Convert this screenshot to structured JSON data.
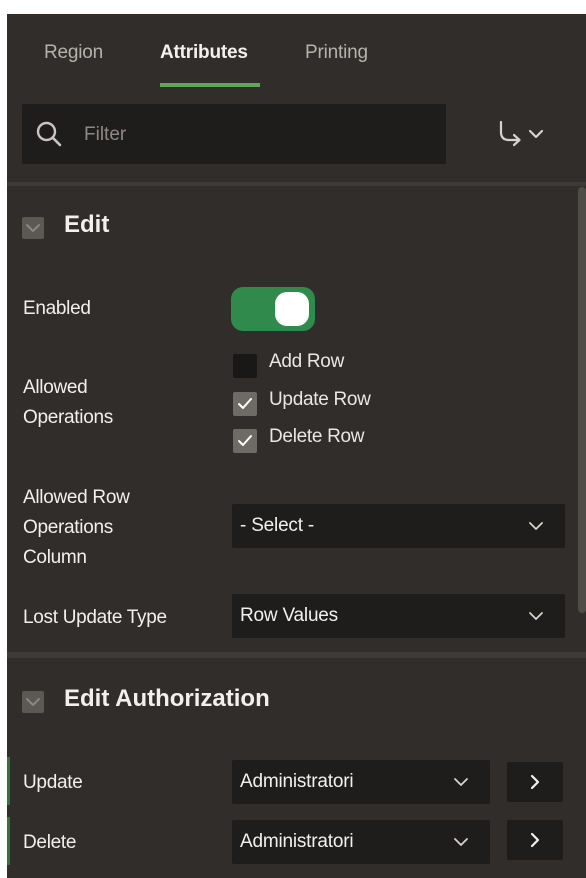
{
  "tabs": [
    {
      "label": "Region",
      "active": false
    },
    {
      "label": "Attributes",
      "active": true
    },
    {
      "label": "Printing",
      "active": false
    }
  ],
  "search": {
    "placeholder": "Filter",
    "value": ""
  },
  "goto_menu": {
    "icon": "goto-arrow-icon"
  },
  "sections": {
    "edit": {
      "title": "Edit",
      "enabled": {
        "label": "Enabled",
        "value": true
      },
      "allowed_operations": {
        "label": "Allowed Operations",
        "label_line1": "Allowed",
        "label_line2": "Operations",
        "options": [
          {
            "label": "Add Row",
            "checked": false
          },
          {
            "label": "Update Row",
            "checked": true
          },
          {
            "label": "Delete Row",
            "checked": true
          }
        ]
      },
      "allowed_row_ops_column": {
        "label_line1": "Allowed Row",
        "label_line2": "Operations",
        "label_line3": "Column",
        "value": "- Select -"
      },
      "lost_update_type": {
        "label": "Lost Update Type",
        "value": "Row Values"
      }
    },
    "edit_authorization": {
      "title": "Edit Authorization",
      "update": {
        "label": "Update",
        "value": "Administratori"
      },
      "delete": {
        "label": "Delete",
        "value": "Administratori"
      }
    }
  },
  "colors": {
    "panel_bg": "#302d2b",
    "field_bg": "#1f1d1b",
    "accent_green": "#64a35b",
    "switch_on": "#2f8a4c"
  }
}
